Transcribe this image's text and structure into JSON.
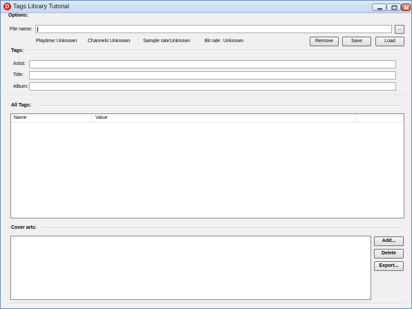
{
  "window": {
    "title": "Tags Library Tutorial"
  },
  "options": {
    "label": "Options:",
    "file_name_label": "File name:",
    "file_name_value": "",
    "browse_label": "...",
    "info": {
      "playtime_label": "Playtime:",
      "playtime_value": "Unknown",
      "channels_label": "Channels:",
      "channels_value": "Unknown",
      "sample_rate_label": "Sample rate:",
      "sample_rate_value": "Unknown",
      "bit_rate_label": "Bit rate:",
      "bit_rate_value": "Unknown"
    },
    "buttons": {
      "remove": "Remove",
      "save": "Save",
      "load": "Load"
    }
  },
  "tags": {
    "label": "Tags:",
    "artist_label": "Artist:",
    "artist_value": "",
    "title_label": "Title:",
    "title_value": "",
    "album_label": "Album:",
    "album_value": ""
  },
  "all_tags": {
    "label": "All Tags:",
    "columns": [
      "Name",
      "Value"
    ],
    "rows": []
  },
  "cover_arts": {
    "label": "Cover arts:",
    "buttons": {
      "add": "Add...",
      "delete": "Delete",
      "export": "Export..."
    }
  }
}
